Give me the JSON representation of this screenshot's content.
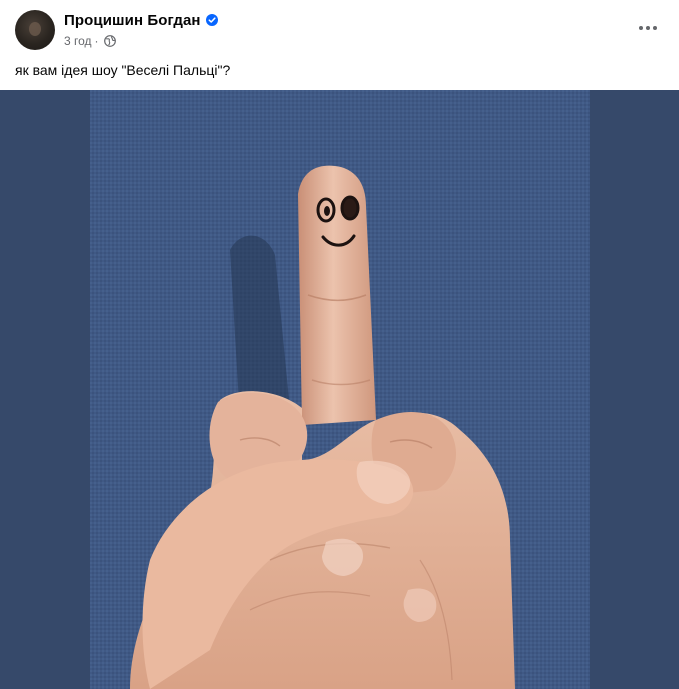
{
  "post": {
    "author": "Процишин Богдан",
    "time": "3 год",
    "separator": "·",
    "text": "як вам ідея шоу \"Веселі Пальці\"?"
  },
  "icons": {
    "verified": "verified-badge-icon",
    "audience": "globe-icon",
    "more": "more-horizontal-icon"
  },
  "colors": {
    "name": "#050505",
    "meta": "#65676b",
    "verified_badge": "#0866ff",
    "media_background": "#36496a",
    "fabric": "#46618f",
    "skin": "#e3b49c"
  }
}
